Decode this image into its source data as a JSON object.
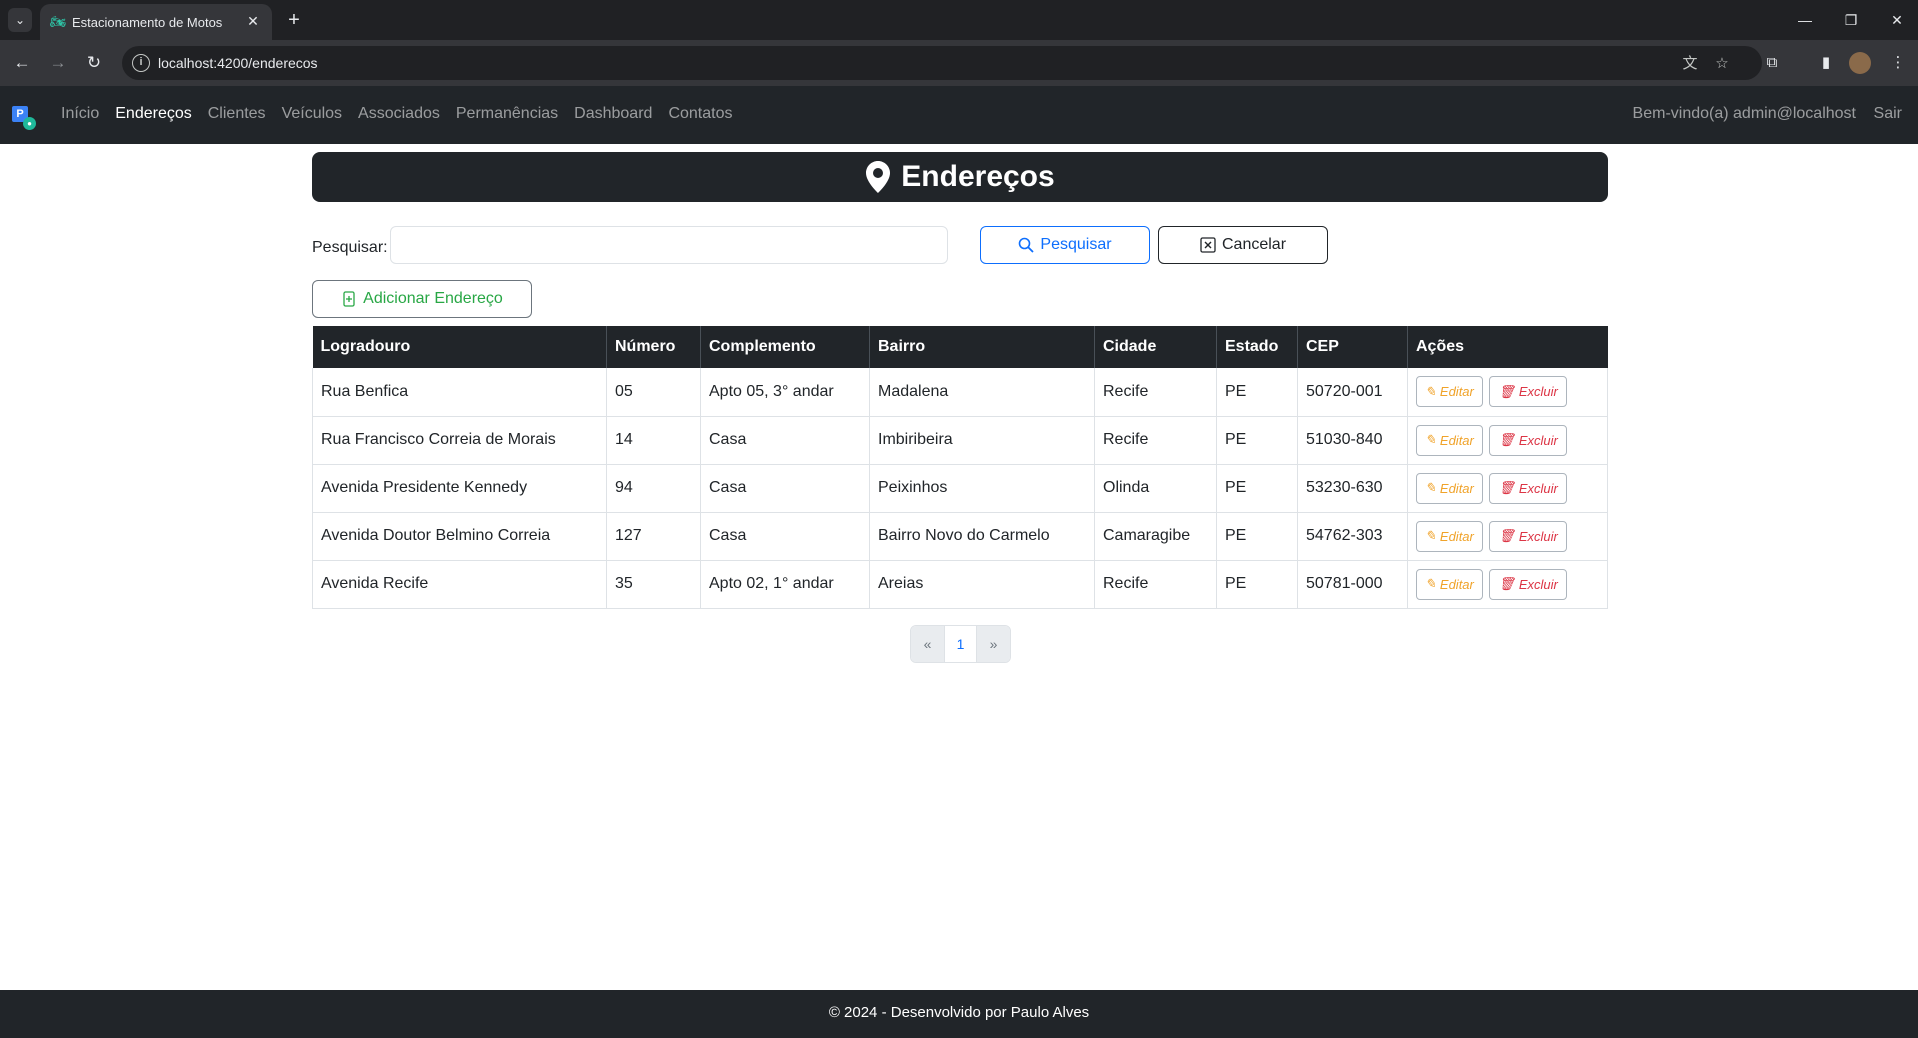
{
  "browser": {
    "tab_title": "Estacionamento de Motos",
    "url": "localhost:4200/enderecos"
  },
  "navbar": {
    "links": [
      "Início",
      "Endereços",
      "Clientes",
      "Veículos",
      "Associados",
      "Permanências",
      "Dashboard",
      "Contatos"
    ],
    "active": "Endereços",
    "welcome": "Bem-vindo(a) admin@localhost",
    "logout": "Sair"
  },
  "page": {
    "title": "Endereços",
    "search_label": "Pesquisar:",
    "search_value": "",
    "search_button": "Pesquisar",
    "cancel_button": "Cancelar",
    "add_button": "Adicionar Endereço"
  },
  "table": {
    "headers": [
      "Logradouro",
      "Número",
      "Complemento",
      "Bairro",
      "Cidade",
      "Estado",
      "CEP",
      "Ações"
    ],
    "rows": [
      [
        "Rua Benfica",
        "05",
        "Apto 05, 3° andar",
        "Madalena",
        "Recife",
        "PE",
        "50720-001"
      ],
      [
        "Rua Francisco Correia de Morais",
        "14",
        "Casa",
        "Imbiribeira",
        "Recife",
        "PE",
        "51030-840"
      ],
      [
        "Avenida Presidente Kennedy",
        "94",
        "Casa",
        "Peixinhos",
        "Olinda",
        "PE",
        "53230-630"
      ],
      [
        "Avenida Doutor Belmino Correia",
        "127",
        "Casa",
        "Bairro Novo do Carmelo",
        "Camaragibe",
        "PE",
        "54762-303"
      ],
      [
        "Avenida Recife",
        "35",
        "Apto 02, 1° andar",
        "Areias",
        "Recife",
        "PE",
        "50781-000"
      ]
    ],
    "edit_label": "Editar",
    "delete_label": "Excluir"
  },
  "pagination": {
    "prev": "«",
    "current": "1",
    "next": "»"
  },
  "footer": {
    "text": "© 2024 - Desenvolvido por Paulo Alves"
  }
}
